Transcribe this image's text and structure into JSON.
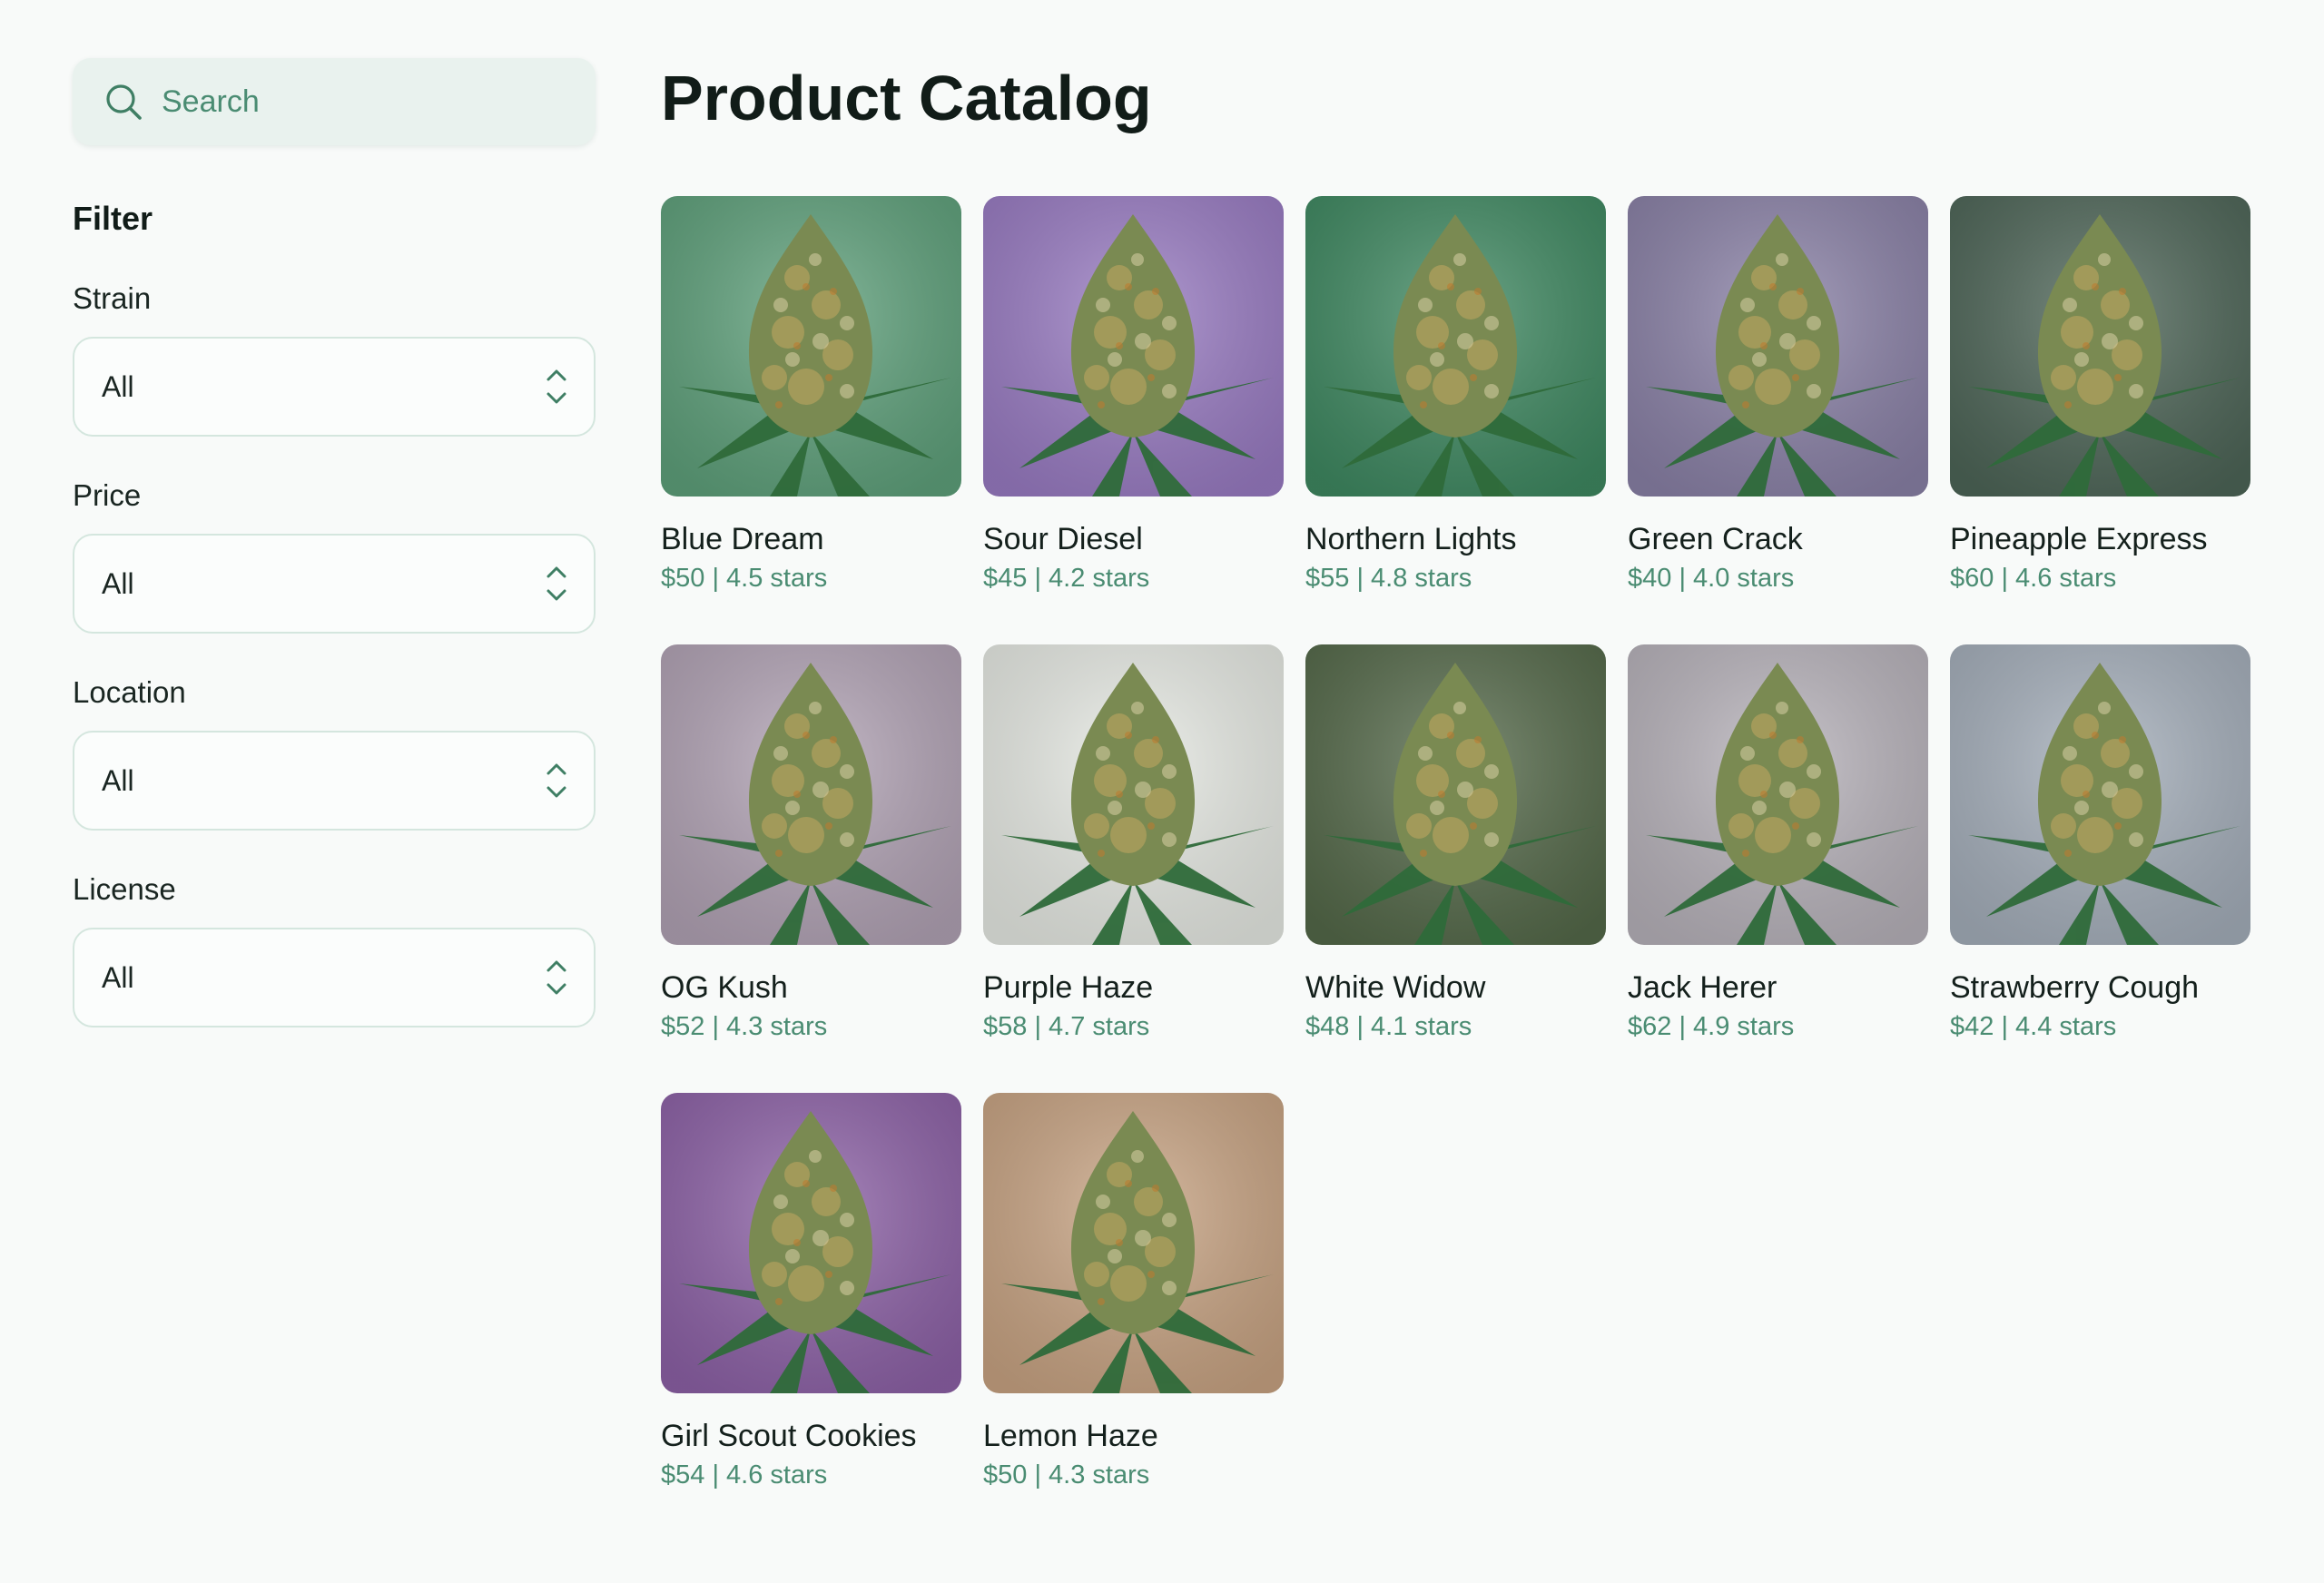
{
  "search": {
    "placeholder": "Search"
  },
  "filters": {
    "title": "Filter",
    "groups": [
      {
        "label": "Strain",
        "value": "All"
      },
      {
        "label": "Price",
        "value": "All"
      },
      {
        "label": "Location",
        "value": "All"
      },
      {
        "label": "License",
        "value": "All"
      }
    ]
  },
  "main": {
    "title": "Product Catalog"
  },
  "products": [
    {
      "name": "Blue Dream",
      "price": "$50",
      "rating": "4.5 stars",
      "meta": "$50 | 4.5 stars",
      "bg": "#5fa27c"
    },
    {
      "name": "Sour Diesel",
      "price": "$45",
      "rating": "4.2 stars",
      "meta": "$45 | 4.2 stars",
      "bg": "#9a7cc4"
    },
    {
      "name": "Northern Lights",
      "price": "$55",
      "rating": "4.8 stars",
      "meta": "$55 | 4.8 stars",
      "bg": "#3f8a62"
    },
    {
      "name": "Green Crack",
      "price": "$40",
      "rating": "4.0 stars",
      "meta": "$40 | 4.0 stars",
      "bg": "#8b82a8"
    },
    {
      "name": "Pineapple Express",
      "price": "$60",
      "rating": "4.6 stars",
      "meta": "$60 | 4.6 stars",
      "bg": "#4e6658"
    },
    {
      "name": "OG Kush",
      "price": "$52",
      "rating": "4.3 stars",
      "meta": "$52 | 4.3 stars",
      "bg": "#b3a4b6"
    },
    {
      "name": "Purple Haze",
      "price": "$58",
      "rating": "4.7 stars",
      "meta": "$58 | 4.7 stars",
      "bg": "#e9ece6"
    },
    {
      "name": "White Widow",
      "price": "$48",
      "rating": "4.1 stars",
      "meta": "$48 | 4.1 stars",
      "bg": "#556a4a"
    },
    {
      "name": "Jack Herer",
      "price": "$62",
      "rating": "4.9 stars",
      "meta": "$62 | 4.9 stars",
      "bg": "#b9b4bc"
    },
    {
      "name": "Strawberry Cough",
      "price": "$42",
      "rating": "4.4 stars",
      "meta": "$42 | 4.4 stars",
      "bg": "#a6b0bc"
    },
    {
      "name": "Girl Scout Cookies",
      "price": "$54",
      "rating": "4.6 stars",
      "meta": "$54 | 4.6 stars",
      "bg": "#8e62a8"
    },
    {
      "name": "Lemon Haze",
      "price": "$50",
      "rating": "4.3 stars",
      "meta": "$50 | 4.3 stars",
      "bg": "#caa584"
    }
  ],
  "colors": {
    "background": "#f8faf9",
    "accent": "#4a8c72",
    "search_bg": "#e9f2ee",
    "border": "#d4e6de"
  },
  "icons": [
    "search-icon",
    "select-arrows-icon"
  ]
}
